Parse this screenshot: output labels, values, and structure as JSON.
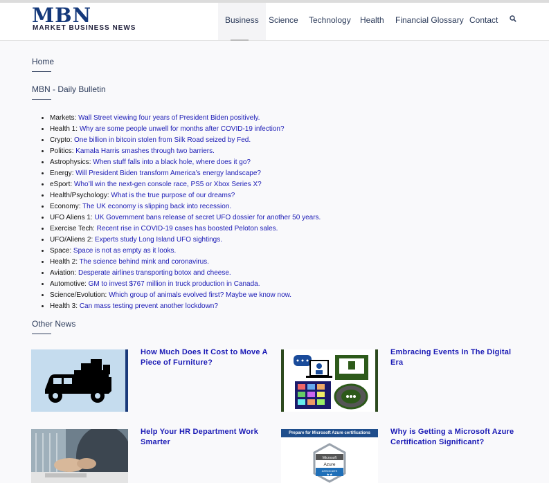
{
  "header": {
    "logo_main": "MBN",
    "logo_sub": "MARKET BUSINESS NEWS",
    "nav": [
      "Business",
      "Science",
      "Technology",
      "Health",
      "Financial Glossary",
      "Contact"
    ]
  },
  "breadcrumb": "Home",
  "bulletin_title": "MBN - Daily Bulletin",
  "bulletin": [
    {
      "cat": "Markets",
      "text": "Wall Street viewing four years of President Biden positively."
    },
    {
      "cat": "Health 1",
      "text": "Why are some people unwell for months after COVID-19 infection?"
    },
    {
      "cat": "Crypto",
      "text": "One billion in bitcoin stolen from Silk Road seized by Fed."
    },
    {
      "cat": "Politics",
      "text": "Kamala Harris smashes through two barriers."
    },
    {
      "cat": "Astrophysics",
      "text": "When stuff falls into a black hole, where does it go?"
    },
    {
      "cat": "Energy",
      "text": "Will President Biden transform America’s energy landscape?"
    },
    {
      "cat": "eSport",
      "text": "Who’ll win the next-gen console race, PS5 or Xbox Series X?"
    },
    {
      "cat": "Health/Psychology",
      "text": "What is the true purpose of our dreams?"
    },
    {
      "cat": "Economy",
      "text": "The UK economy is slipping back into recession."
    },
    {
      "cat": "UFO Aliens 1",
      "text": "UK Government bans release of secret UFO dossier for another 50 years."
    },
    {
      "cat": "Exercise Tech",
      "text": "Recent rise in COVID-19 cases has boosted Peloton sales."
    },
    {
      "cat": "UFO/Aliens 2",
      "text": "Experts study Long Island UFO sightings."
    },
    {
      "cat": "Space",
      "text": "Space is not as empty as it looks."
    },
    {
      "cat": "Health 2",
      "text": "The science behind mink and coronavirus."
    },
    {
      "cat": "Aviation",
      "text": "Desperate airlines transporting botox and cheese."
    },
    {
      "cat": "Automotive",
      "text": "GM to invest $767 million in truck production in Canada."
    },
    {
      "cat": "Science/Evolution",
      "text": "Which group of animals evolved first? Maybe we know now."
    },
    {
      "cat": "Health 3",
      "text": "Can mass testing prevent another lockdown?"
    }
  ],
  "other_news_title": "Other News",
  "articles": [
    {
      "title": "How Much Does It Cost to Move A Piece of Furniture?"
    },
    {
      "title": "Embracing Events In The Digital Era"
    },
    {
      "title": "Help Your HR Department Work Smarter"
    },
    {
      "title": "Why is Getting a Microsoft Azure Certification Significant?"
    }
  ],
  "azure_image": {
    "banner": "Prepare for Microsoft Azure certifications",
    "badge_top": "Microsoft",
    "badge_mid": "Azure",
    "badge_bottom": "ASSOCIATE"
  },
  "colors": {
    "brand": "#14387a",
    "link": "#1a1ab5",
    "azure": "#1f4e8c"
  }
}
